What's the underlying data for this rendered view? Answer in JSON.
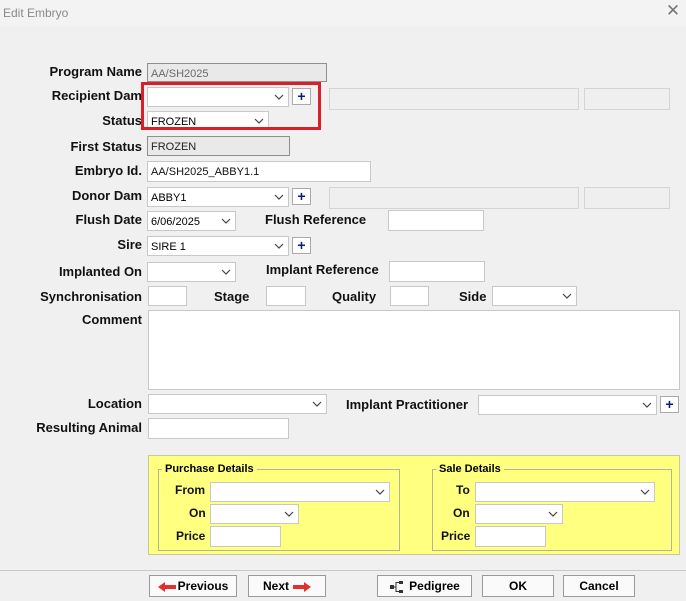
{
  "window": {
    "title": "Edit Embryo"
  },
  "form": {
    "program_name_label": "Program Name",
    "program_name_value": "AA/SH2025",
    "recipient_dam_label": "Recipient Dam",
    "recipient_dam_value": "",
    "status_label": "Status",
    "status_value": "FROZEN",
    "first_status_label": "First Status",
    "first_status_value": "FROZEN",
    "embryo_id_label": "Embryo Id.",
    "embryo_id_value": "AA/SH2025_ABBY1.1",
    "donor_dam_label": "Donor Dam",
    "donor_dam_value": "ABBY1",
    "flush_date_label": "Flush Date",
    "flush_date_value": "6/06/2025",
    "flush_reference_label": "Flush Reference",
    "flush_reference_value": "",
    "sire_label": "Sire",
    "sire_value": "SIRE 1",
    "implanted_on_label": "Implanted On",
    "implanted_on_value": "",
    "implant_reference_label": "Implant Reference",
    "implant_reference_value": "",
    "synchronisation_label": "Synchronisation",
    "stage_label": "Stage",
    "quality_label": "Quality",
    "side_label": "Side",
    "comment_label": "Comment",
    "location_label": "Location",
    "implant_practitioner_label": "Implant Practitioner",
    "resulting_animal_label": "Resulting Animal",
    "plus_symbol": "+"
  },
  "purchase": {
    "title": "Purchase Details",
    "from_label": "From",
    "on_label": "On",
    "price_label": "Price"
  },
  "sale": {
    "title": "Sale Details",
    "to_label": "To",
    "on_label": "On",
    "price_label": "Price"
  },
  "buttons": {
    "previous": "Previous",
    "next": "Next",
    "pedigree": "Pedigree",
    "ok": "OK",
    "cancel": "Cancel"
  },
  "colors": {
    "highlight": "#d9202a",
    "panel": "#ffff80",
    "plus": "#0a1e78",
    "arrow": "#e03030"
  }
}
